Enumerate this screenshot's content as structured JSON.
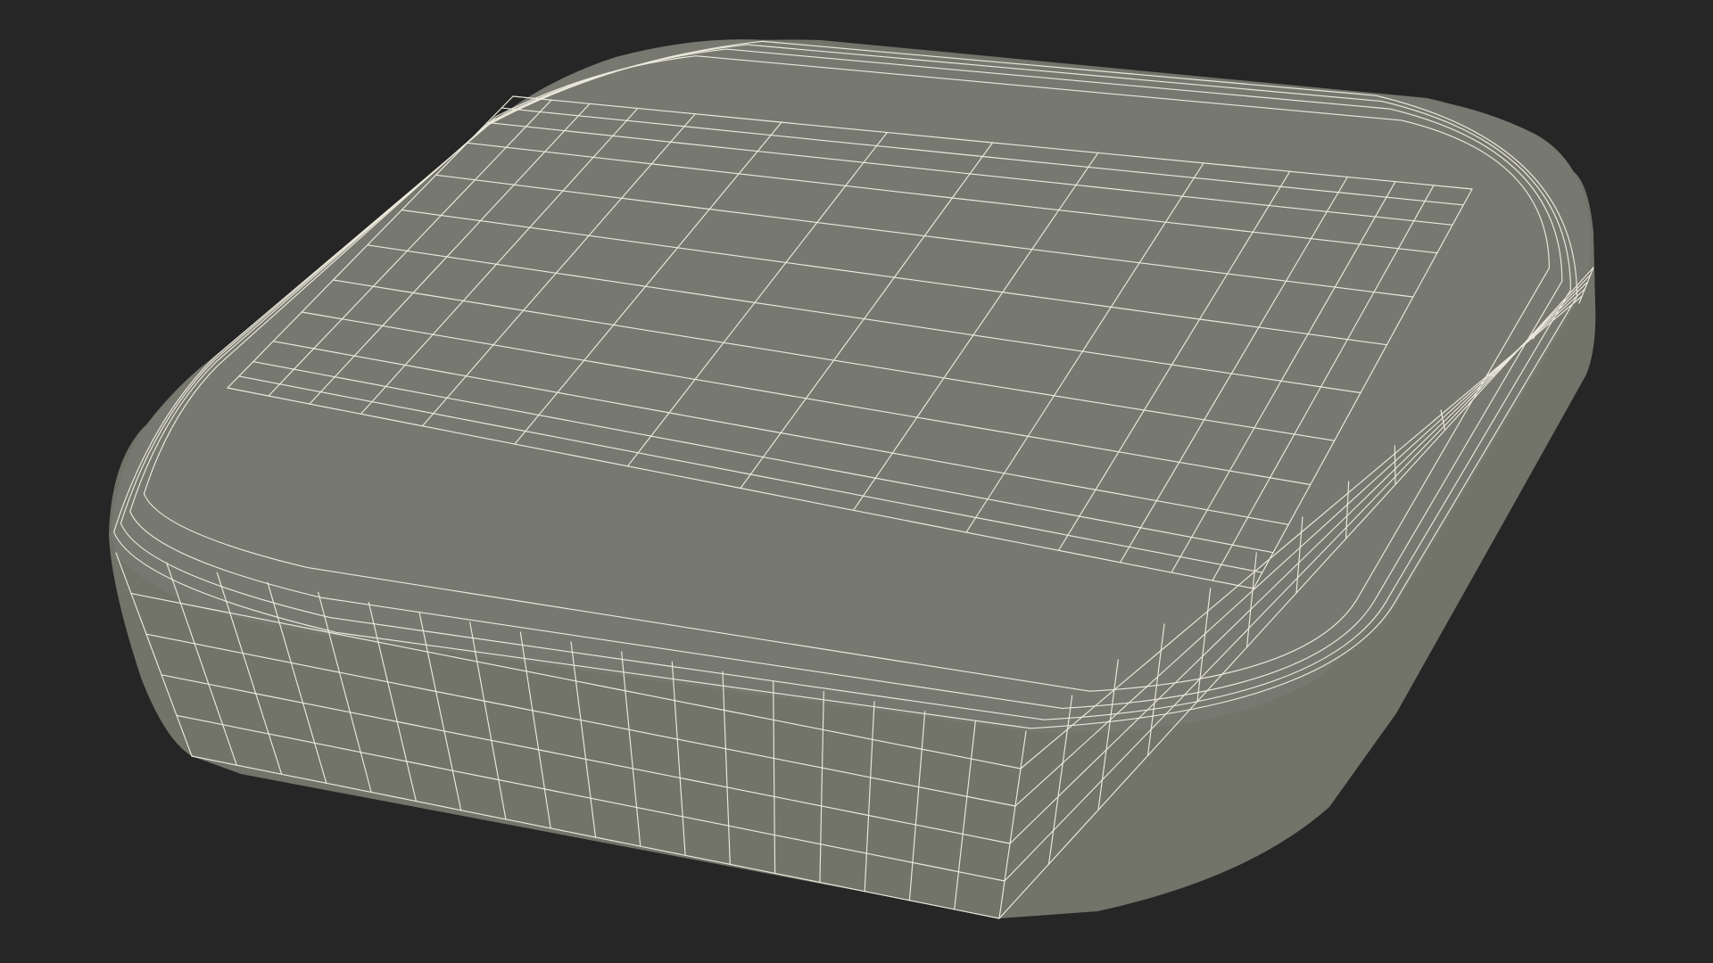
{
  "scene": {
    "subject": "rounded-square-slab-wireframe",
    "colors": {
      "background": "#262626",
      "surface": "#777870",
      "side_face": "#727369",
      "wire": "#ece9dc"
    }
  }
}
